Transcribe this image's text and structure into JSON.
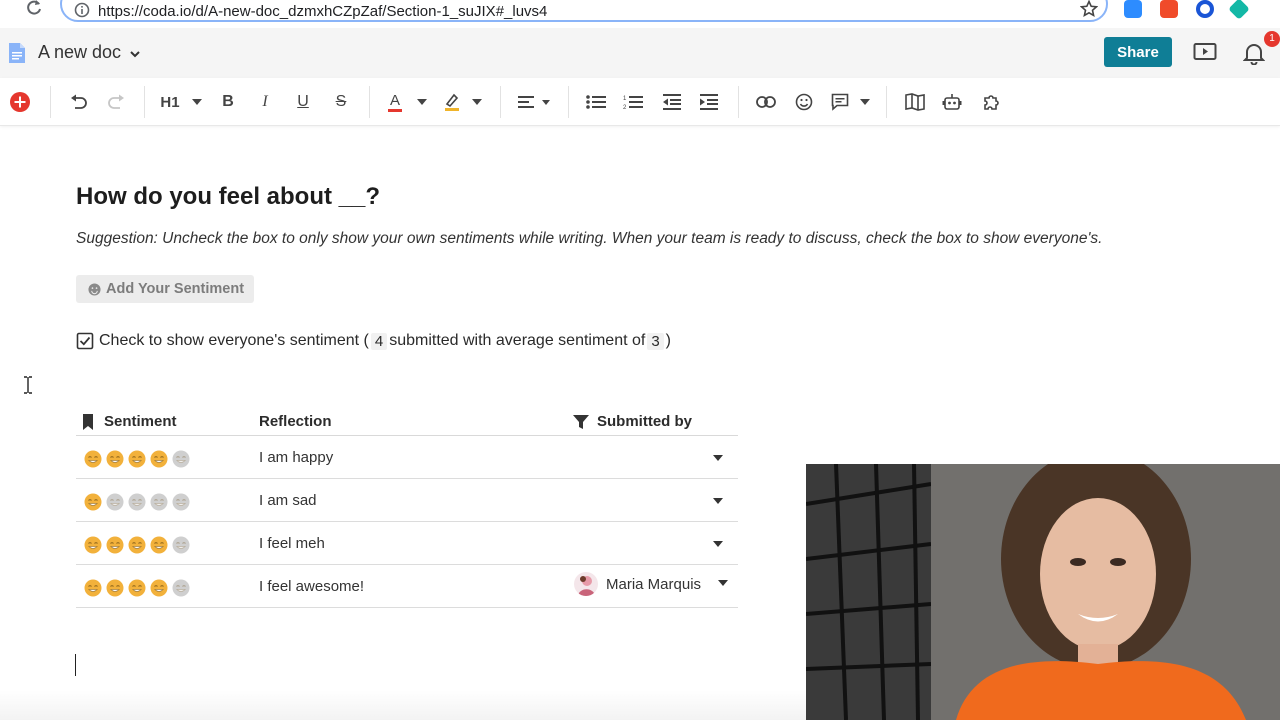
{
  "browser": {
    "url": "https://coda.io/d/A-new-doc_dzmxhCZpZaf/Section-1_suJIX#_luvs4"
  },
  "app": {
    "doc_title": "A new doc",
    "share_label": "Share",
    "notification_count": "1"
  },
  "toolbar": {
    "heading_label": "H1",
    "bold_label": "B",
    "italic_label": "I",
    "underline_label": "U",
    "strike_label": "S",
    "text_color_label": "A",
    "colors": {
      "brand": "#0f7e96",
      "add": "#e5372e",
      "text_color": "#e5372e",
      "highlight": "#f0b42a"
    }
  },
  "content": {
    "heading": "How do you feel about __?",
    "suggestion": "Suggestion:  Uncheck the box to only show your own sentiments while writing.  When your team is ready to discuss, check the box to show everyone's.",
    "add_button": "Add Your Sentiment",
    "check_pre": "Check to show everyone's sentiment (",
    "check_count": "4",
    "check_mid": "submitted with average sentiment of",
    "check_avg": "3",
    "check_post": ")"
  },
  "table": {
    "headers": {
      "sentiment": "Sentiment",
      "reflection": "Reflection",
      "submitted_by": "Submitted by"
    },
    "rows": [
      {
        "rating": 4,
        "reflection": "I am happy",
        "submitted_by": ""
      },
      {
        "rating": 1,
        "reflection": "I am sad",
        "submitted_by": ""
      },
      {
        "rating": 4,
        "reflection": "I feel meh",
        "submitted_by": ""
      },
      {
        "rating": 4,
        "reflection": "I feel awesome!",
        "submitted_by": "Maria Marquis"
      }
    ],
    "max_rating": 5,
    "colors": {
      "face_on": "#f2b13b",
      "face_off": "#cfcfcf"
    }
  }
}
